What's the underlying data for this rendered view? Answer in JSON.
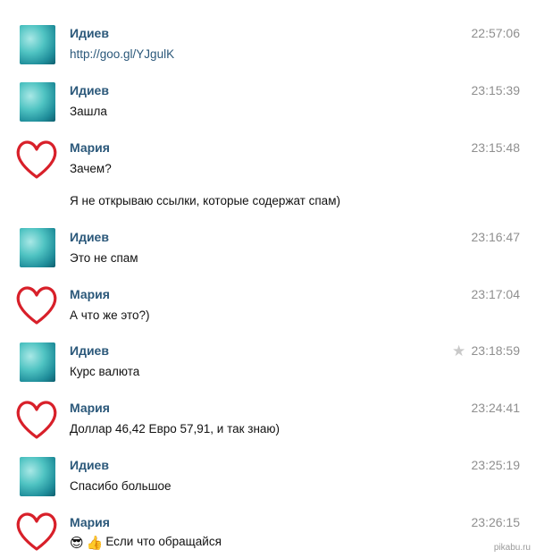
{
  "chat": {
    "messages": [
      {
        "sender": "Идиев",
        "time": "22:57:06",
        "lines": [
          "http://goo.gl/YJgulK"
        ],
        "avatar": "teal-photo",
        "link": true
      },
      {
        "sender": "Идиев",
        "time": "23:15:39",
        "lines": [
          "Зашла"
        ],
        "avatar": "teal-photo"
      },
      {
        "sender": "Мария",
        "time": "23:15:48",
        "lines": [
          "Зачем?",
          "Я не открываю ссылки, которые содержат спам)"
        ],
        "avatar": "heart"
      },
      {
        "sender": "Идиев",
        "time": "23:16:47",
        "lines": [
          "Это не спам"
        ],
        "avatar": "teal-photo"
      },
      {
        "sender": "Мария",
        "time": "23:17:04",
        "lines": [
          "А что же это?)"
        ],
        "avatar": "heart"
      },
      {
        "sender": "Идиев",
        "time": "23:18:59",
        "lines": [
          "Курс валюта"
        ],
        "avatar": "teal-photo",
        "starred": true
      },
      {
        "sender": "Мария",
        "time": "23:24:41",
        "lines": [
          "Доллар 46,42 Евро 57,91, и так знаю)"
        ],
        "avatar": "heart"
      },
      {
        "sender": "Идиев",
        "time": "23:25:19",
        "lines": [
          "Спасибо большое"
        ],
        "avatar": "teal-photo"
      },
      {
        "sender": "Мария",
        "time": "23:26:15",
        "lines": [
          "Если что обращайся"
        ],
        "avatar": "heart",
        "emoji": [
          "sunglasses-emoji",
          "thumbs-up-emoji"
        ]
      }
    ]
  },
  "watermark": "pikabu.ru",
  "colors": {
    "name": "#2b587a",
    "time": "#8f8f8f",
    "heart": "#d8202a",
    "avatar": "#4fc3c2"
  }
}
